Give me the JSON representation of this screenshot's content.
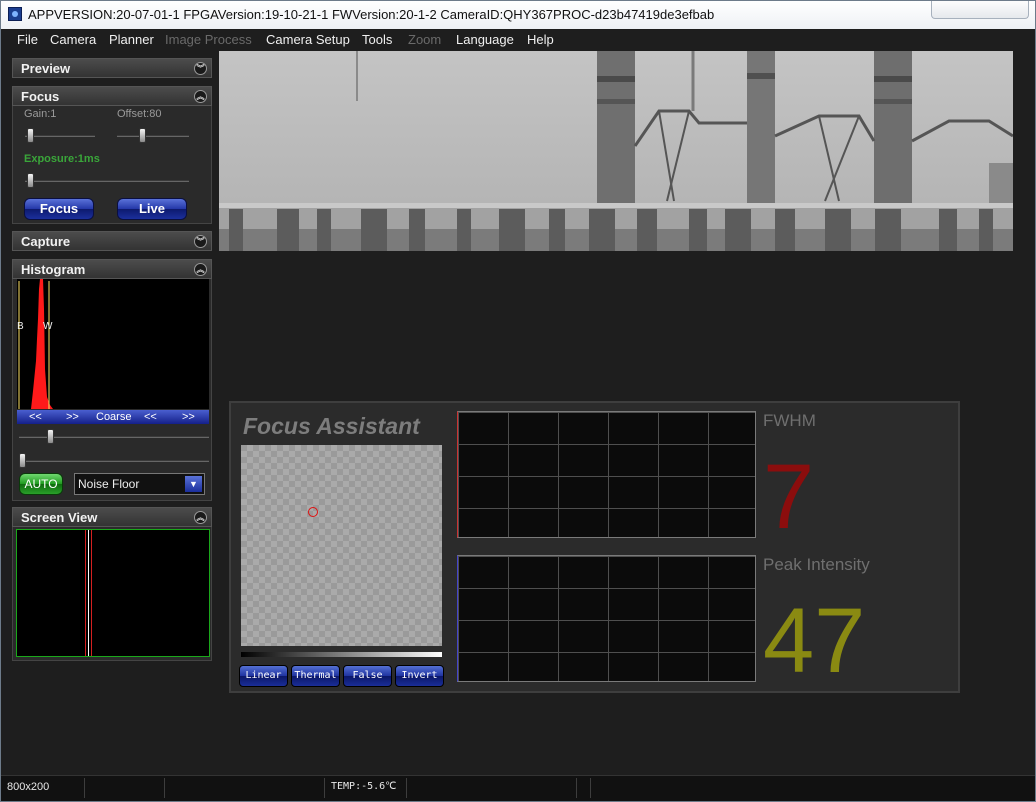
{
  "window": {
    "title": "APPVERSION:20-07-01-1  FPGAVersion:19-10-21-1  FWVersion:20-1-2  CameraID:QHY367PROC-d23b47419de3efbab"
  },
  "menu": [
    {
      "label": "File",
      "enabled": true
    },
    {
      "label": "Camera",
      "enabled": true
    },
    {
      "label": "Planner",
      "enabled": true
    },
    {
      "label": "Image Process",
      "enabled": false
    },
    {
      "label": "Camera Setup",
      "enabled": true
    },
    {
      "label": "Tools",
      "enabled": true
    },
    {
      "label": "Zoom",
      "enabled": false
    },
    {
      "label": "Language",
      "enabled": true
    },
    {
      "label": "Help",
      "enabled": true
    }
  ],
  "panels": {
    "preview": {
      "title": "Preview",
      "collapsed": true
    },
    "focus": {
      "title": "Focus",
      "gain_label": "Gain:1",
      "offset_label": "Offset:80",
      "exposure_label": "Exposure:1ms",
      "focus_button": "Focus",
      "live_button": "Live"
    },
    "capture": {
      "title": "Capture",
      "collapsed": true
    },
    "histogram": {
      "title": "Histogram",
      "b_marker": "B",
      "w_marker": "W",
      "nav": [
        "<<",
        ">>",
        "Coarse",
        "<<",
        ">>"
      ],
      "auto_button": "AUTO",
      "noise_select": "Noise Floor"
    },
    "screen_view": {
      "title": "Screen View"
    }
  },
  "focus_assistant": {
    "title": "Focus Assistant",
    "fwhm_label": "FWHM",
    "fwhm_value": "7",
    "peak_label": "Peak Intensity",
    "peak_value": "47",
    "buttons": [
      "Linear",
      "Thermal",
      "False",
      "Invert"
    ]
  },
  "status": {
    "resolution": "800x200",
    "temp": "TEMP:-5.6℃"
  },
  "colors": {
    "fwhm_value": "#8b0d0d",
    "peak_value": "#8a8a12",
    "exposure_label": "#3aa63a",
    "histogram_bar": "#ff1a1a"
  }
}
